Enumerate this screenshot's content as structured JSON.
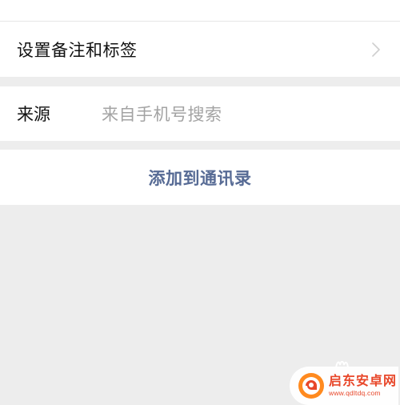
{
  "remark_row": {
    "title": "设置备注和标签",
    "icon": "chevron-right-icon"
  },
  "source_row": {
    "label": "来源",
    "value": "来自手机号搜索"
  },
  "add_action": {
    "label": "添加到通讯录"
  },
  "watermark": {
    "name": "启东安卓网",
    "url": "www.qdltdq.com",
    "logo_icon": "qidong-logo-icon"
  },
  "colors": {
    "background": "#ededed",
    "card": "#ffffff",
    "link": "#576b95",
    "placeholder": "#a3a3a3",
    "watermark": "#e8472a"
  }
}
